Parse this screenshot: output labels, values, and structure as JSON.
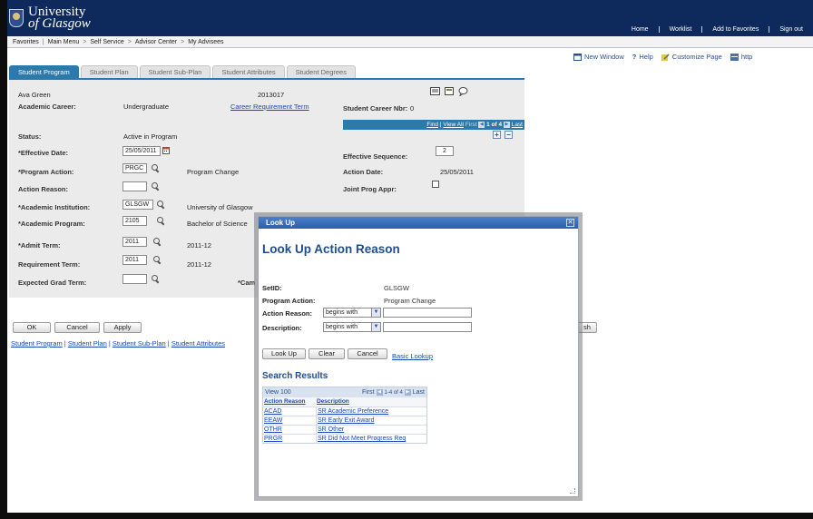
{
  "header": {
    "logo_line1": "University",
    "logo_line2": "of Glasgow",
    "links": [
      "Home",
      "Worklist",
      "Add to Favorites",
      "Sign out"
    ]
  },
  "menubar": {
    "favorites": "Favorites",
    "main_menu": "Main Menu",
    "sep": ">",
    "self_service": "Self Service",
    "advisor_center": "Advisor Center",
    "my_advisees": "My Advisees"
  },
  "utility": {
    "new_window": "New Window",
    "help": "Help",
    "customize": "Customize Page",
    "http": "http"
  },
  "tabs": [
    "Student Program",
    "Student Plan",
    "Student Sub-Plan",
    "Student Attributes",
    "Student Degrees"
  ],
  "student": {
    "name": "Ava Green",
    "id": "2013017",
    "career_label": "Academic Career:",
    "career_value": "Undergraduate",
    "career_req_link": "Career Requirement Term",
    "career_nbr_label": "Student Career Nbr:",
    "career_nbr_value": "0"
  },
  "grid_nav": {
    "find": "Find",
    "view_all": "View All",
    "first": "First",
    "range": "1 of 4",
    "last": "Last"
  },
  "form": {
    "status_label": "Status:",
    "status_value": "Active in Program",
    "eff_date_label": "*Effective Date:",
    "eff_date_value": "25/05/2011",
    "eff_seq_label": "Effective Sequence:",
    "eff_seq_value": "2",
    "prog_action_label": "*Program Action:",
    "prog_action_value": "PRGC",
    "prog_action_desc": "Program Change",
    "action_date_label": "Action Date:",
    "action_date_value": "25/05/2011",
    "action_reason_label": "Action Reason:",
    "action_reason_value": "",
    "joint_label": "Joint Prog Appr:",
    "acad_inst_label": "*Academic Institution:",
    "acad_inst_value": "GLSGW",
    "acad_inst_desc": "University of Glasgow",
    "acad_prog_label": "*Academic Program:",
    "acad_prog_value": "2105",
    "acad_prog_desc": "Bachelor of Science",
    "admit_label": "*Admit Term:",
    "admit_value": "2011",
    "admit_desc": "2011-12",
    "req_term_label": "Requirement Term:",
    "req_term_value": "2011",
    "req_term_desc": "2011-12",
    "exp_grad_label": "Expected Grad Term:",
    "exp_grad_value": "",
    "campus_partial": "*Cam"
  },
  "buttons": {
    "ok": "OK",
    "cancel": "Cancel",
    "apply": "Apply",
    "partial_right": "sh"
  },
  "bottom_links": [
    "Student Program",
    "Student Plan",
    "Student Sub-Plan",
    "Student Attributes"
  ],
  "modal": {
    "title": "Look Up",
    "heading": "Look Up Action Reason",
    "setid_label": "SetID:",
    "setid_value": "GLSGW",
    "prog_action_label": "Program Action:",
    "prog_action_value": "Program Change",
    "action_reason_label": "Action Reason:",
    "description_label": "Description:",
    "operator": "begins with",
    "btn_lookup": "Look Up",
    "btn_clear": "Clear",
    "btn_cancel": "Cancel",
    "basic_lookup": "Basic Lookup",
    "results_heading": "Search Results",
    "view100": "View 100",
    "first": "First",
    "range": "1-4 of 4",
    "last": "Last",
    "col_reason": "Action Reason",
    "col_desc": "Description",
    "rows": [
      {
        "code": "ACAD",
        "desc": "SR Academic Preference"
      },
      {
        "code": "EEAW",
        "desc": "SR Early Exit Award"
      },
      {
        "code": "OTHR",
        "desc": "SR Other"
      },
      {
        "code": "PRGR",
        "desc": "SR Did Not Meet Progress Req"
      }
    ]
  }
}
